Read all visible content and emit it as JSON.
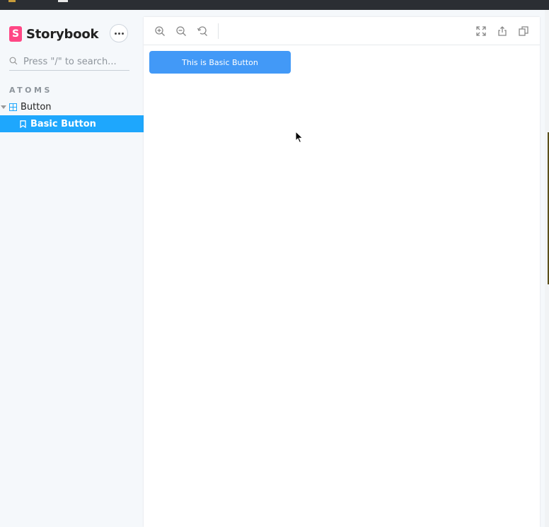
{
  "sidebar": {
    "brand": {
      "logo_letter": "S",
      "name": "Storybook"
    },
    "search": {
      "placeholder": "Press \"/\" to search...",
      "value": ""
    },
    "section_label": "ATOMS",
    "tree": {
      "group_label": "Button",
      "story_label": "Basic Button"
    }
  },
  "preview": {
    "toolbar": {
      "left_tools": [
        "zoom-in-icon",
        "zoom-out-icon",
        "reset-zoom-icon"
      ],
      "right_tools": [
        "fullscreen-icon",
        "share-icon",
        "copy-icon"
      ]
    },
    "button_label": "This is Basic Button"
  },
  "colors": {
    "accent": "#1ea7fd",
    "brand": "#ff4785",
    "demo_button": "#4299f7"
  }
}
